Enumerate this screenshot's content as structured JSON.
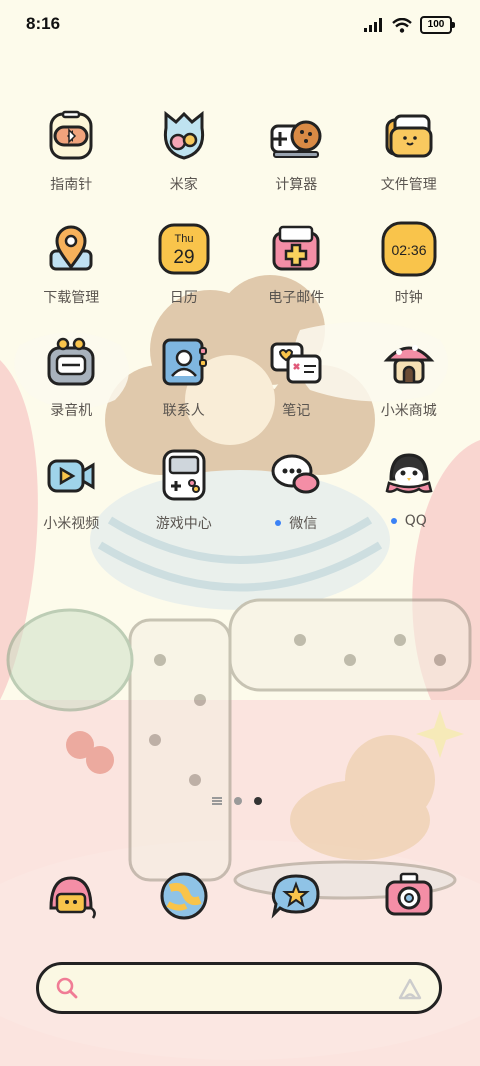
{
  "status_bar": {
    "time": "8:16",
    "battery": "100"
  },
  "apps": [
    {
      "label": "指南针",
      "icon": "compass-icon",
      "dot": false
    },
    {
      "label": "米家",
      "icon": "mijia-icon",
      "dot": false
    },
    {
      "label": "计算器",
      "icon": "calculator-icon",
      "dot": false
    },
    {
      "label": "文件管理",
      "icon": "folder-icon",
      "dot": false
    },
    {
      "label": "下载管理",
      "icon": "download-icon",
      "dot": false
    },
    {
      "label": "日历",
      "icon": "calendar-icon",
      "dot": false
    },
    {
      "label": "电子邮件",
      "icon": "mail-icon",
      "dot": false
    },
    {
      "label": "时钟",
      "icon": "clock-icon",
      "dot": false
    },
    {
      "label": "录音机",
      "icon": "recorder-icon",
      "dot": false
    },
    {
      "label": "联系人",
      "icon": "contacts-icon",
      "dot": false
    },
    {
      "label": "笔记",
      "icon": "notes-icon",
      "dot": false
    },
    {
      "label": "小米商城",
      "icon": "mi-store-icon",
      "dot": false
    },
    {
      "label": "小米视频",
      "icon": "video-icon",
      "dot": false
    },
    {
      "label": "游戏中心",
      "icon": "game-center-icon",
      "dot": false
    },
    {
      "label": "微信",
      "icon": "wechat-icon",
      "dot": true
    },
    {
      "label": "QQ",
      "icon": "qq-icon",
      "dot": true
    }
  ],
  "calendar_icon": {
    "weekday": "Thu",
    "day": "29"
  },
  "clock_icon": {
    "time": "02:36"
  },
  "pager": {
    "pages": 2,
    "active": 2
  },
  "dock": [
    {
      "icon": "phone-icon"
    },
    {
      "icon": "messages-icon"
    },
    {
      "icon": "browser-icon"
    },
    {
      "icon": "camera-icon"
    }
  ],
  "search": {
    "placeholder": ""
  },
  "colors": {
    "dot": "#3b82f6",
    "outline": "#222222",
    "label": "#5a5550"
  }
}
